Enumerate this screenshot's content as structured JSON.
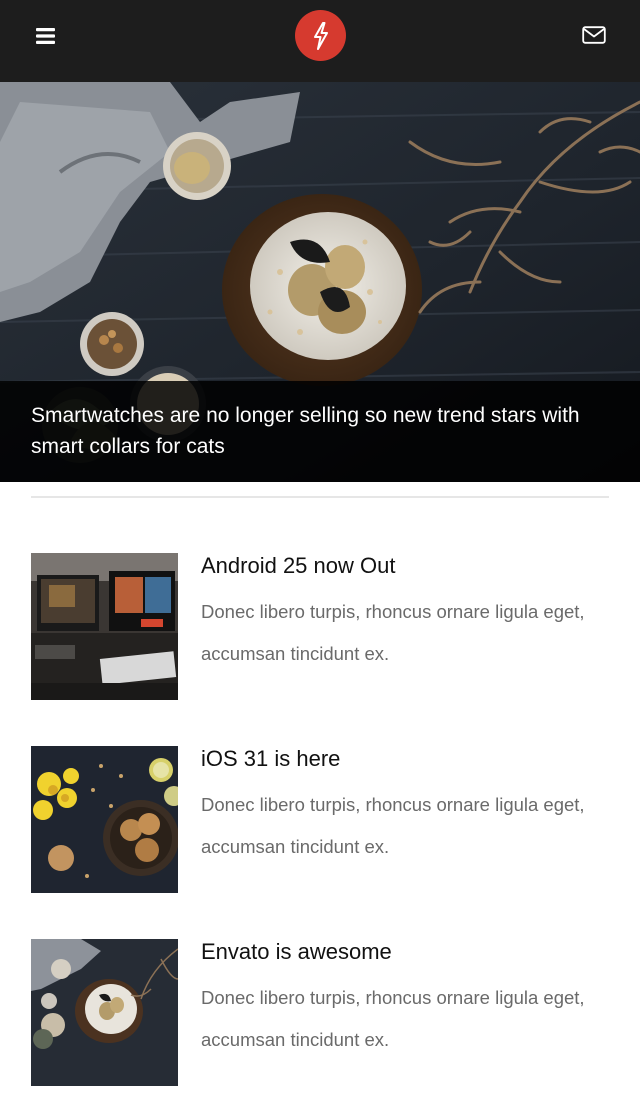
{
  "header": {
    "menu_icon": "hamburger-menu-icon",
    "logo_icon": "lightning-bolt-icon",
    "mail_icon": "envelope-icon",
    "brand_color": "#d63a2f",
    "bar_color": "#1d1d1d"
  },
  "hero": {
    "title": "Smartwatches are no longer selling so new trend stars with smart collars for cats"
  },
  "articles": [
    {
      "title": "Android 25 now Out",
      "description": "Donec libero turpis, rhoncus ornare ligula eget, accumsan tincidunt ex."
    },
    {
      "title": "iOS 31 is here",
      "description": "Donec libero turpis, rhoncus ornare ligula eget, accumsan tincidunt ex."
    },
    {
      "title": "Envato is awesome",
      "description": "Donec libero turpis, rhoncus ornare ligula eget, accumsan tincidunt ex."
    }
  ]
}
